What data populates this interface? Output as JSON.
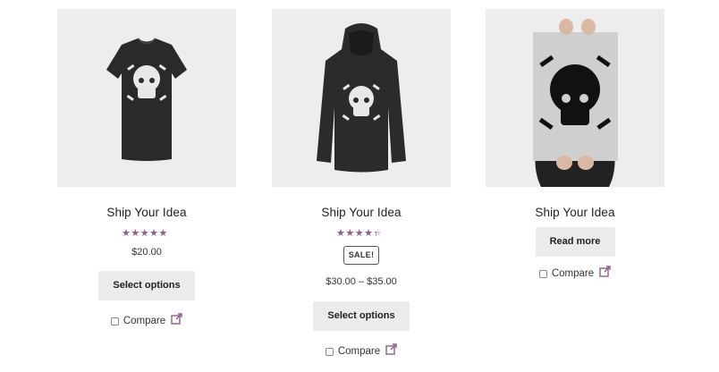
{
  "colors": {
    "thumb_bg": "#ededed",
    "star_filled": "#8f5e8c",
    "star_empty": "#e2cfe0",
    "button_bg": "#ebebeb",
    "external_link": "#8f5e8c"
  },
  "products": [
    {
      "title": "Ship Your Idea",
      "image": "black-tshirt-skull",
      "rating": 4.5,
      "rating_max": 5,
      "stars_text": "★★★★★",
      "price": "$20.00",
      "button": "Select options",
      "compare": "Compare"
    },
    {
      "title": "Ship Your Idea",
      "image": "black-hoodie-skull",
      "rating": 4,
      "rating_max": 5,
      "stars_text": "★★★★★",
      "sale_badge": "SALE!",
      "price": "$30.00 – $35.00",
      "button": "Select options",
      "compare": "Compare"
    },
    {
      "title": "Ship Your Idea",
      "image": "poster-held-skull",
      "button": "Read more",
      "compare": "Compare"
    }
  ]
}
